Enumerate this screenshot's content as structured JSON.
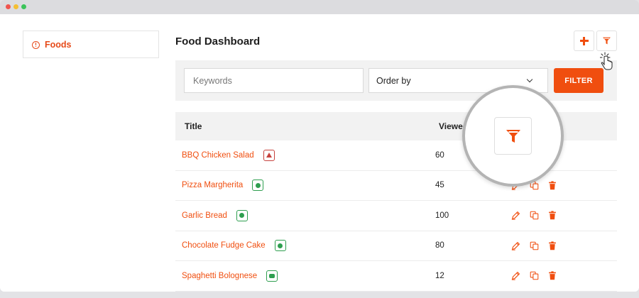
{
  "sidebar": {
    "items": [
      {
        "label": "Foods",
        "icon": "info-circle-icon"
      }
    ]
  },
  "header": {
    "title": "Food Dashboard",
    "add_icon": "plus-icon",
    "filter_icon": "funnel-icon"
  },
  "filters": {
    "keywords_placeholder": "Keywords",
    "order_by_value": "Order by",
    "filter_button_label": "FILTER"
  },
  "table": {
    "columns": [
      "Title",
      "Viewed"
    ],
    "rows": [
      {
        "title": "BBQ Chicken Salad",
        "badge": "non-veg",
        "views": "60"
      },
      {
        "title": "Pizza Margherita",
        "badge": "veg",
        "views": "45"
      },
      {
        "title": "Garlic Bread",
        "badge": "veg",
        "views": "100"
      },
      {
        "title": "Chocolate Fudge Cake",
        "badge": "veg",
        "views": "80"
      },
      {
        "title": "Spaghetti Bolognese",
        "badge": "egg",
        "views": "12"
      }
    ]
  },
  "colors": {
    "accent": "#f04e0f",
    "veg": "#2e9e4f",
    "non_veg": "#c6423d"
  }
}
